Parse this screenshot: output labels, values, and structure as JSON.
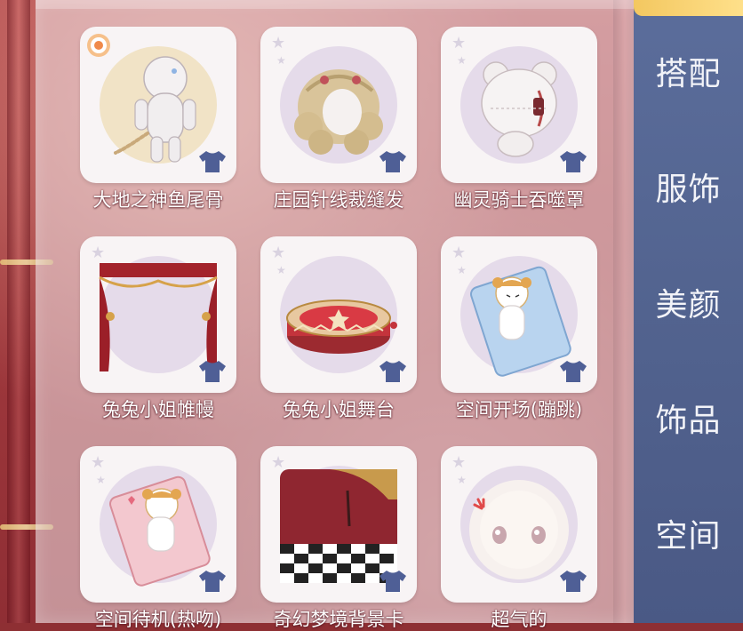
{
  "items": [
    {
      "label": "大地之神鱼尾骨",
      "icon": "bone-tail-plush-icon"
    },
    {
      "label": "庄园针线裁缝发",
      "icon": "curly-hair-icon"
    },
    {
      "label": "幽灵骑士吞噬罩",
      "icon": "bear-mask-icon"
    },
    {
      "label": "兔兔小姐帷幔",
      "icon": "stage-curtain-icon"
    },
    {
      "label": "兔兔小姐舞台",
      "icon": "round-stage-icon"
    },
    {
      "label": "空间开场(蹦跳)",
      "icon": "hamster-card-icon"
    },
    {
      "label": "空间待机(热吻)",
      "icon": "hamster-card-pink-icon"
    },
    {
      "label": "奇幻梦境背景卡",
      "icon": "checker-floor-scene-icon"
    },
    {
      "label": "超气的",
      "icon": "angry-face-bubble-icon"
    }
  ],
  "sidebar": {
    "items": [
      {
        "label": "搭配"
      },
      {
        "label": "服饰"
      },
      {
        "label": "美颜"
      },
      {
        "label": "饰品"
      },
      {
        "label": "空间"
      }
    ]
  },
  "colors": {
    "sidebar": "#52638f",
    "sidebar_active": "#f3c760",
    "card": "#f8f4f5",
    "halo": "#e5dbea",
    "shirt_icon": "#4f5f96",
    "background": "#a23a3e"
  }
}
